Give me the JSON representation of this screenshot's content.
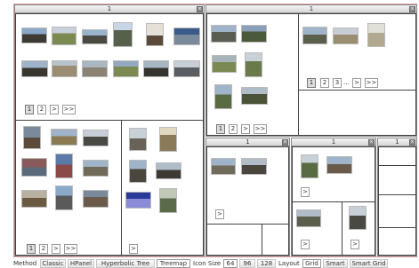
{
  "panels": {
    "main": {
      "title": "1"
    },
    "top_right": {
      "title": "1"
    },
    "mid_a": {
      "title": "1"
    },
    "mid_b": {
      "title": "1"
    },
    "mid_c": {
      "title": "1"
    }
  },
  "paging": {
    "one": "1",
    "two": "2",
    "three": "3",
    "next": ">",
    "last": ">>",
    "ellipsis": "..."
  },
  "thumb_colors": {
    "sky": "#8aa8c8",
    "mountain": "#6f6a5a",
    "grass": "#7b8a52",
    "dark": "#3d3a33",
    "snow": "#d8dde3",
    "ruin": "#9a8d72",
    "sunset": "#5a4a8a"
  },
  "bottombar": {
    "method_label": "Method",
    "methods": [
      "Classic",
      "HPanel",
      "Hyperbolic Tree",
      "Treemap"
    ],
    "selected_method": "Treemap",
    "icon_size_label": "Icon Size",
    "icon_sizes": [
      "64",
      "96",
      "128"
    ],
    "selected_icon_size": "64",
    "layout_label": "Layout",
    "layouts": [
      "Grid",
      "Smart",
      "Smart Grid"
    ],
    "selected_layout": "Grid"
  }
}
